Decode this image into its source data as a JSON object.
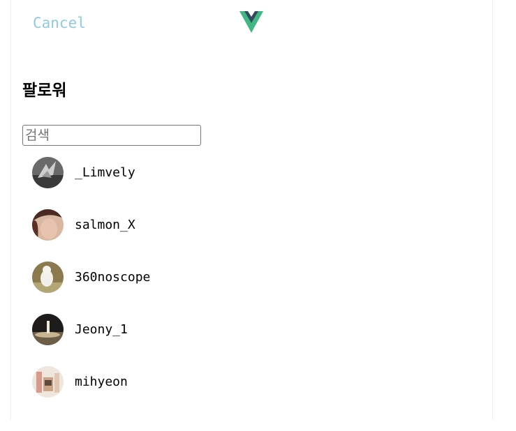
{
  "header": {
    "cancel_label": "Cancel",
    "logo_icon": "vue-logo-icon"
  },
  "page": {
    "title": "팔로워"
  },
  "search": {
    "placeholder": "검색",
    "value": ""
  },
  "followers": [
    {
      "username": "_Limvely",
      "avatar_icon": "avatar-icon"
    },
    {
      "username": "salmon_X",
      "avatar_icon": "avatar-icon"
    },
    {
      "username": "360noscope",
      "avatar_icon": "avatar-icon"
    },
    {
      "username": "Jeony_1",
      "avatar_icon": "avatar-icon"
    },
    {
      "username": "mihyeon",
      "avatar_icon": "avatar-icon"
    }
  ],
  "colors": {
    "cancel": "#8fcbe0",
    "vue_green": "#41b883",
    "vue_dark": "#35495e"
  }
}
